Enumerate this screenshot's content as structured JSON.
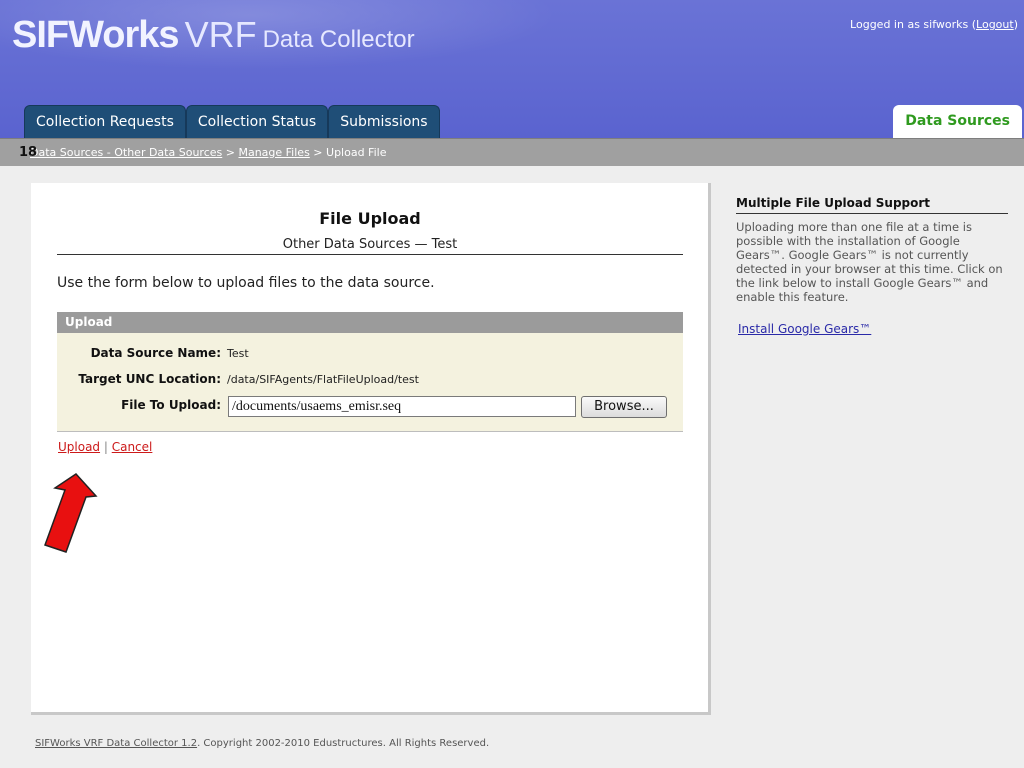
{
  "header": {
    "logo_part1": "SIFWorks",
    "logo_part2": "VRF",
    "logo_part3": "Data Collector",
    "login_prefix": "Logged in as sifworks (",
    "logout_label": "Logout",
    "login_suffix": ")"
  },
  "tabs": [
    {
      "label": "Collection Requests"
    },
    {
      "label": "Collection Status"
    },
    {
      "label": "Submissions"
    }
  ],
  "active_tab": {
    "label": "Data Sources"
  },
  "breadcrumb": {
    "slide_number": "18",
    "item1": "Data Sources - Other Data Sources",
    "sep": " > ",
    "item2": "Manage Files",
    "item3": "Upload File"
  },
  "main": {
    "title": "File Upload",
    "subtitle": "Other Data Sources — Test",
    "intro": "Use the form below to upload files to the data source."
  },
  "upload_box": {
    "heading": "Upload",
    "name_label": "Data Source Name:",
    "name_value": "Test",
    "unc_label": "Target UNC Location:",
    "unc_value": "/data/SIFAgents/FlatFileUpload/test",
    "file_label": "File To Upload:",
    "file_value": "/documents/usaems_emisr.seq",
    "browse_label": "Browse..."
  },
  "actions": {
    "upload_label": "Upload",
    "separator": " | ",
    "cancel_label": "Cancel"
  },
  "sidebar": {
    "heading": "Multiple File Upload Support",
    "text": "Uploading more than one file at a time is possible with the installation of Google Gears™. Google Gears™ is not currently detected in your browser at this time. Click on the link below to install Google Gears™ and enable this feature.",
    "link_label": "Install Google Gears™"
  },
  "footer": {
    "product_link": "SIFWorks VRF Data Collector 1.2",
    "copyright": ". Copyright 2002-2010 Edustructures. All Rights Reserved."
  },
  "colors": {
    "header_bg": "#5a63cf",
    "tab_bg": "#1f4e77",
    "active_tab_text": "#2f9a1f",
    "action_link": "#cc1a1a",
    "arrow_fill": "#e81010"
  }
}
